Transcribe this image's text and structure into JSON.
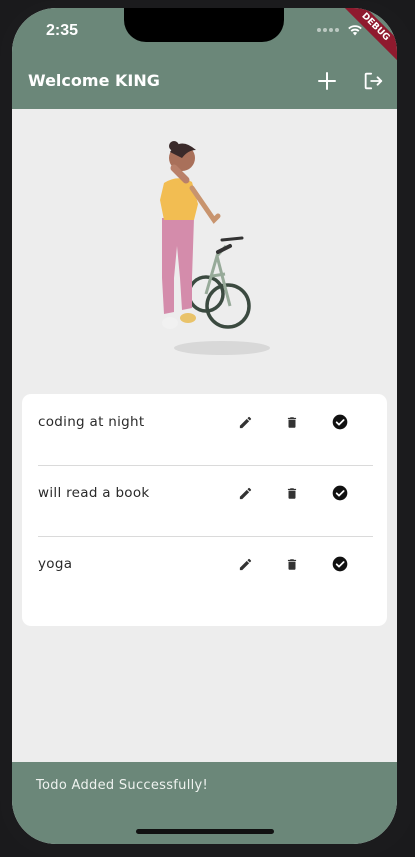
{
  "status_bar": {
    "time": "2:35"
  },
  "debug_banner": "DEBUG",
  "app_bar": {
    "title": "Welcome KING",
    "add_icon": "plus-icon",
    "logout_icon": "logout-icon"
  },
  "todos": [
    {
      "text": "coding at night"
    },
    {
      "text": "will read a book"
    },
    {
      "text": "yoga"
    }
  ],
  "todo_actions": {
    "edit_icon": "pencil-icon",
    "delete_icon": "trash-icon",
    "complete_icon": "check-circle-icon"
  },
  "snackbar": {
    "message": "Todo Added Successfully!"
  },
  "colors": {
    "app_bar": "#6b8779",
    "background": "#ededed",
    "card": "#ffffff"
  }
}
